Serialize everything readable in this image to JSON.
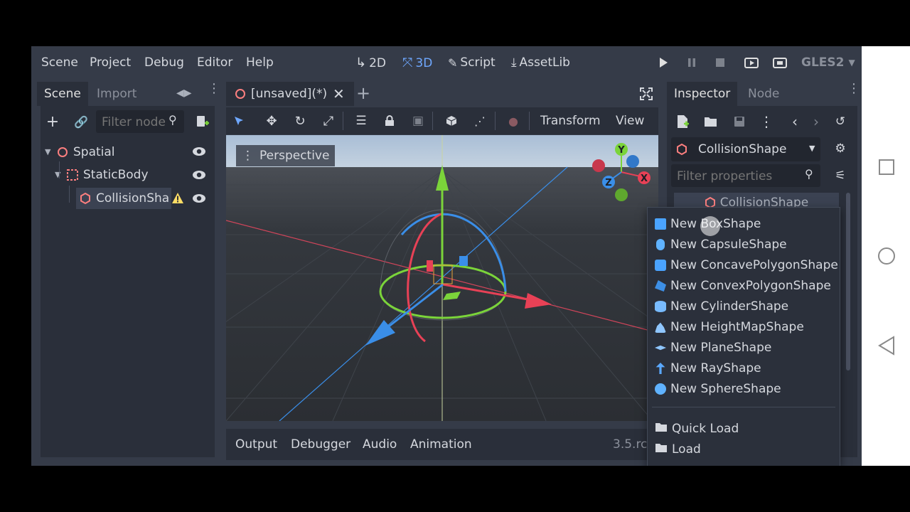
{
  "menu": {
    "scene": "Scene",
    "project": "Project",
    "debug": "Debug",
    "editor": "Editor",
    "help": "Help"
  },
  "modes": {
    "mode_2d": "2D",
    "mode_3d": "3D",
    "script": "Script",
    "assetlib": "AssetLib"
  },
  "renderer": "GLES2",
  "scene_dock": {
    "tab_scene": "Scene",
    "tab_import": "Import",
    "filter_placeholder": "Filter node",
    "nodes": [
      {
        "label": "Spatial"
      },
      {
        "label": "StaticBody"
      },
      {
        "label": "CollisionSha"
      }
    ]
  },
  "editor_tab": {
    "title": "[unsaved](*)"
  },
  "viewport_toolbar": {
    "transform": "Transform",
    "view": "View"
  },
  "viewport": {
    "perspective": "Perspective",
    "gizmo_y": "Y",
    "gizmo_x": "X",
    "gizmo_z": "Z"
  },
  "bottom_panel": {
    "output": "Output",
    "debugger": "Debugger",
    "audio": "Audio",
    "animation": "Animation",
    "version": "3.5.rc"
  },
  "inspector": {
    "tab_inspector": "Inspector",
    "tab_node": "Node",
    "object_name": "CollisionShape",
    "filter_placeholder": "Filter properties",
    "section": "CollisionShape"
  },
  "shape_menu": {
    "items": [
      {
        "label": "New BoxShape",
        "color": "#4aa3ff"
      },
      {
        "label": "New CapsuleShape",
        "color": "#5fb2ff"
      },
      {
        "label": "New ConcavePolygonShape",
        "color": "#4aa3ff"
      },
      {
        "label": "New ConvexPolygonShape",
        "color": "#3d8fe6"
      },
      {
        "label": "New CylinderShape",
        "color": "#78bbff"
      },
      {
        "label": "New HeightMapShape",
        "color": "#8fc6ff"
      },
      {
        "label": "New PlaneShape",
        "color": "#8fc6ff"
      },
      {
        "label": "New RayShape",
        "color": "#5aa8ff"
      },
      {
        "label": "New SphereShape",
        "color": "#5fb2ff"
      }
    ],
    "quick_load": "Quick Load",
    "load": "Load"
  },
  "colors": {
    "accent": "#6fa8ff",
    "node_red": "#fc7f7f",
    "warning": "#ffdd65",
    "axis_x": "#e84156",
    "axis_y": "#7bd43a",
    "axis_z": "#3a8ee8"
  }
}
